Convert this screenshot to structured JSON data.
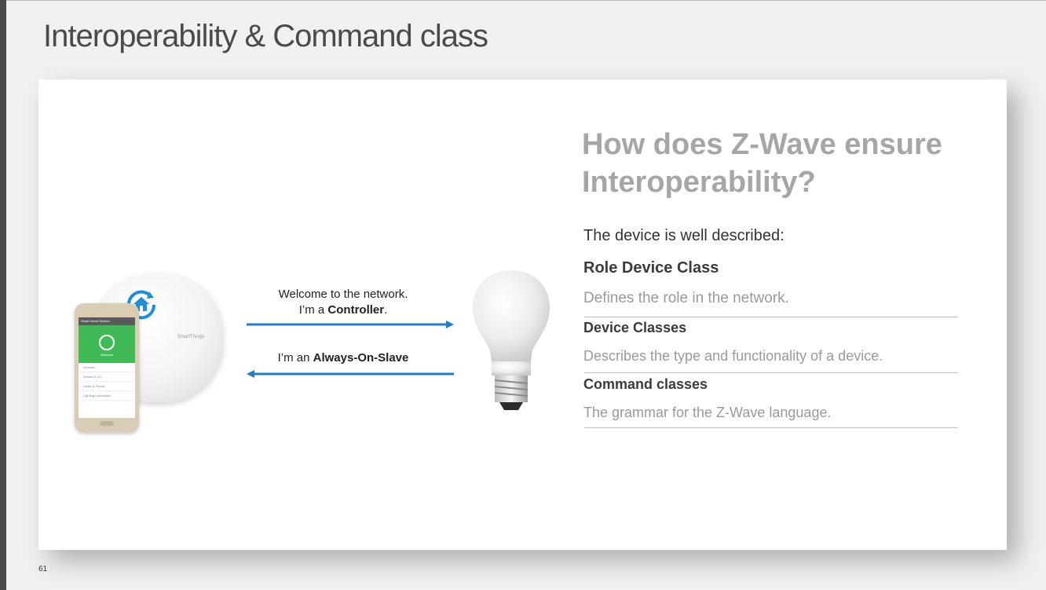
{
  "slide": {
    "title": "Interoperability & Command class",
    "page_number": "61"
  },
  "illustration": {
    "hub_brand": "SmartThings",
    "phone_header": "Smart Home Monitor",
    "phone_status": "Welcome",
    "phone_list": [
      "Intrusion",
      "Smoke & CO",
      "Leaks & Floods",
      "Lighting Automation"
    ]
  },
  "messages": {
    "welcome_line1": "Welcome to the network.",
    "welcome_line2_prefix": "I’m a ",
    "welcome_line2_bold": "Controller",
    "welcome_line2_suffix": ".",
    "reply_prefix": "I’m an ",
    "reply_bold": "Always-On-Slave"
  },
  "panel": {
    "heading": "How does Z-Wave ensure Interoperability?",
    "intro": "The device is well described:",
    "classes": [
      {
        "title": "Role Device Class",
        "description": "Defines the role in the network."
      },
      {
        "title": "Device Classes",
        "description": "Describes the type and functionality of a device."
      },
      {
        "title": "Command classes",
        "description": "The grammar for the Z-Wave language."
      }
    ]
  },
  "colors": {
    "arrow": "#1f7fc8",
    "hub_logo": "#1c8fd6",
    "heading": "#a6a6a6"
  },
  "icons": [
    "home-sync-icon",
    "arrow-right-icon",
    "arrow-left-icon",
    "light-bulb-icon"
  ]
}
